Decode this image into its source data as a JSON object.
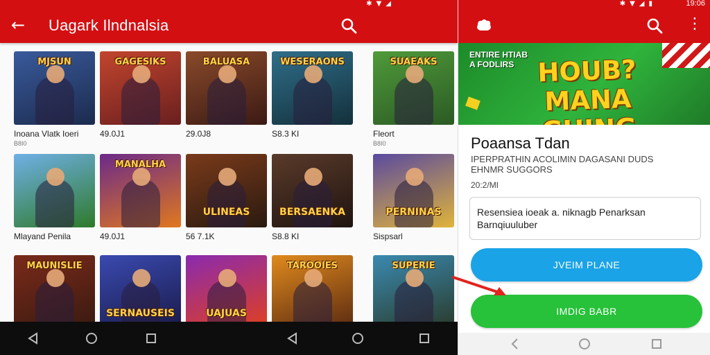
{
  "left_screen": {
    "status_bar": {
      "icons": [
        "bluetooth-icon",
        "wifi-icon",
        "signal-icon"
      ],
      "time": ""
    },
    "app_bar": {
      "title": "Uagark Ilndnalsia"
    },
    "games": [
      {
        "art_text": "MJSUN",
        "title": "Inoana Vlatk Ioeri",
        "sub": "B8I0",
        "colors": [
          "#3a5a9c",
          "#1b2b4d"
        ]
      },
      {
        "art_text": "GAGESIKS",
        "title": "49.0J1",
        "sub": "",
        "colors": [
          "#c2452e",
          "#6a1f1f"
        ]
      },
      {
        "art_text": "BALUASA",
        "title": "29.0J8",
        "sub": "",
        "colors": [
          "#8a4a2a",
          "#3b1a14"
        ]
      },
      {
        "art_text": "WESERAONS",
        "title": "S8.3 KI",
        "sub": "",
        "colors": [
          "#2f6e8a",
          "#14303b"
        ]
      },
      {
        "art_text": "SUAEAKS",
        "title": "Fleort",
        "sub": "B8I0",
        "colors": [
          "#4f9a3a",
          "#2b5a24"
        ]
      },
      {
        "art_text": "",
        "title": "Mlayand Penila",
        "sub": "",
        "colors": [
          "#6fb0e6",
          "#2e7a2a"
        ]
      },
      {
        "art_text": "MANALHA",
        "title": "49.0J1",
        "sub": "",
        "colors": [
          "#6b2a8a",
          "#e0781e"
        ]
      },
      {
        "art_text": "ULINEAS",
        "title": "56 7.1K",
        "sub": "",
        "colors": [
          "#7a3a1a",
          "#2a1a10"
        ]
      },
      {
        "art_text": "BERSAENKA",
        "title": "S8.8 KI",
        "sub": "",
        "colors": [
          "#5a3a2a",
          "#1f1410"
        ]
      },
      {
        "art_text": "PERNINAS",
        "title": "Sispsarl",
        "sub": "",
        "colors": [
          "#5a4aa0",
          "#e0b43a"
        ]
      },
      {
        "art_text": "MAUNISLIE",
        "title": "",
        "sub": "",
        "colors": [
          "#7a2a1a",
          "#3a1a10"
        ]
      },
      {
        "art_text": "SERNAUSEIS",
        "title": "",
        "sub": "",
        "colors": [
          "#3a4ab0",
          "#1a1a4a"
        ]
      },
      {
        "art_text": "UAJUAS",
        "title": "",
        "sub": "",
        "colors": [
          "#8a2ab0",
          "#e0401e"
        ]
      },
      {
        "art_text": "TAROOIES",
        "title": "",
        "sub": "",
        "colors": [
          "#e08a1e",
          "#5a2a10"
        ]
      },
      {
        "art_text": "SUPERIE",
        "title": "",
        "sub": "",
        "colors": [
          "#3a8ab0",
          "#2a3a2a"
        ]
      }
    ],
    "nav_bar": {
      "buttons": [
        "back-triangle-icon",
        "home-circle-icon",
        "recents-square-icon"
      ]
    }
  },
  "right_screen": {
    "status_bar": {
      "icons": [
        "bluetooth-icon",
        "wifi-icon",
        "signal-icon",
        "battery-icon"
      ],
      "time": "19:06"
    },
    "banner": {
      "small_text": "ENTIRE HTIAB\nA FODLIRS",
      "headline": "HOUB?\nMANA GHING"
    },
    "app": {
      "title": "Poaansa Tdan",
      "meta": "IPERPRATHIN ACOLIMIN DAGASANI DUDS\nEHNMR SUGGORS",
      "size": "20:2/MI",
      "description": "Resensiea ioeak a. niknagb Penarksan\nBarnqiuuluber"
    },
    "buttons": {
      "primary": "JVEIM PLANE",
      "secondary": "IMDIG BABR"
    },
    "nav_bar": {
      "buttons": [
        "back-chevron-icon",
        "home-circle-icon",
        "recents-square-icon"
      ]
    },
    "colors": {
      "accent": "#d40f12",
      "blue_button": "#1aa3e6",
      "green_button": "#27c13a"
    }
  }
}
